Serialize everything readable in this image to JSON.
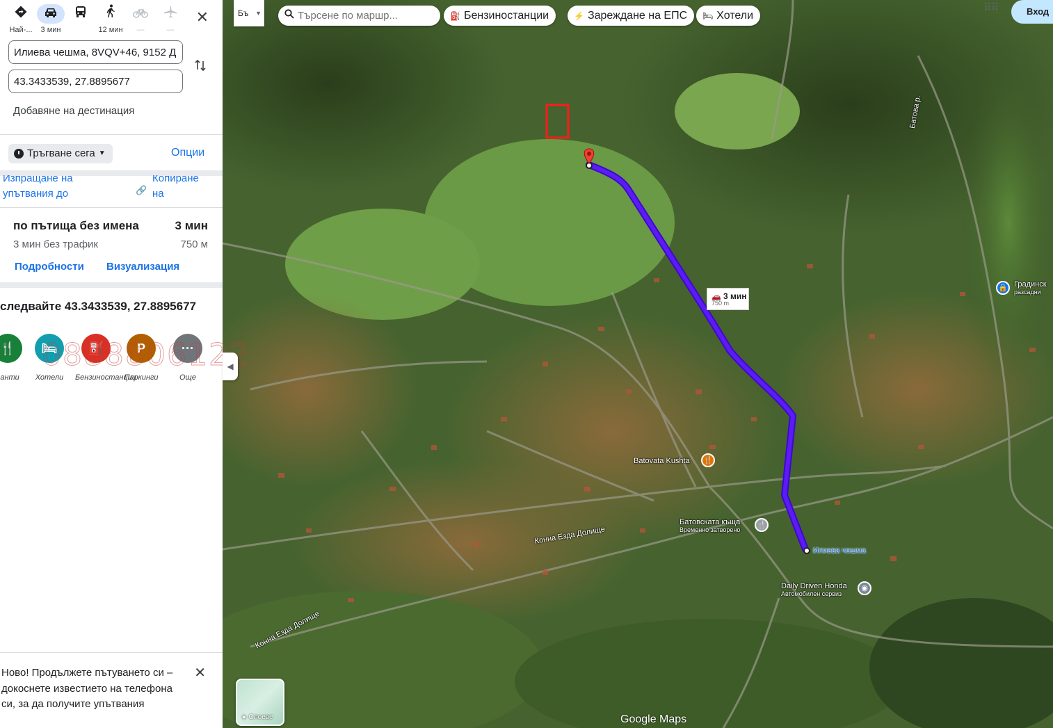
{
  "travel_modes": [
    {
      "icon": "directions-icon",
      "glyph": "◆",
      "label": "Най-...",
      "state": "normal"
    },
    {
      "icon": "car-icon",
      "glyph": "🚗",
      "label": "3 мин",
      "state": "active"
    },
    {
      "icon": "transit-icon",
      "glyph": "🚌",
      "label": "",
      "state": "normal"
    },
    {
      "icon": "walk-icon",
      "glyph": "🚶",
      "label": "12 мин",
      "state": "normal"
    },
    {
      "icon": "bike-icon",
      "glyph": "🚲",
      "label": "—",
      "state": "disabled"
    },
    {
      "icon": "flight-icon",
      "glyph": "✈",
      "label": "—",
      "state": "disabled"
    }
  ],
  "directions": {
    "origin_value": "Илиева чешма, 8VQV+46, 9152 Д",
    "destination_value": "43.3433539, 27.8895677",
    "add_destination": "Добавяне на дестинация",
    "depart_label": "Тръгване сега",
    "options_label": "Опции",
    "cut_left": "Изпращане на\nупътвания до\n...",
    "cut_right": "Копиране\nна\n..."
  },
  "route": {
    "title": "по пътища без имена",
    "time": "3 мин",
    "subtitle": "3 мин без трафик",
    "distance": "750 м",
    "details_link": "Подробности",
    "preview_link": "Визуализация"
  },
  "follow": "следвайте 43.3433539, 27.8895677",
  "categories": [
    {
      "icon": "restaurant-icon",
      "glyph": "🍴",
      "label": "ранти",
      "color": "#188038"
    },
    {
      "icon": "hotel-icon",
      "glyph": "🛏",
      "label": "Хотели",
      "color": "#129eaf"
    },
    {
      "icon": "gas-station-icon",
      "glyph": "⛽",
      "label": "Бензиностанции",
      "color": "#d93025"
    },
    {
      "icon": "parking-icon",
      "glyph": "P",
      "label": "Паркинги",
      "color": "#b06000"
    },
    {
      "icon": "more-icon",
      "glyph": "···",
      "label": "Още",
      "color": "#70757a"
    }
  ],
  "watermark": "0888806122",
  "notification": {
    "text": "Ново! Продължете пътуването си – докоснете известието на телефона си, за да получите упътвания"
  },
  "map": {
    "lang_label": "Бъ",
    "search_placeholder": "Търсене по маршр...",
    "chips": [
      {
        "icon": "gas-station-icon",
        "glyph": "⛽",
        "label": "Бензиностанции"
      },
      {
        "icon": "ev-charging-icon",
        "glyph": "⚡",
        "label": "Зареждане на ЕПС"
      },
      {
        "icon": "hotel-icon",
        "glyph": "🛏",
        "label": "Хотели"
      }
    ],
    "signin_label": "Вход",
    "layers_label": "Слоеве",
    "logo": "Google Maps",
    "route_label_time": "3 мин",
    "route_label_dist": "750 m",
    "places": [
      {
        "name": "Batovata Kushta"
      },
      {
        "name": "Батовската къща",
        "sub": "Временно затворено"
      },
      {
        "name": "Илиева чешма"
      },
      {
        "name": "Daily Driven Honda",
        "sub": "Автомобилен сервиз"
      },
      {
        "name": "Градинск",
        "sub": "разсадни"
      },
      {
        "name": "Конна Езда Долище"
      },
      {
        "name": "Конна Езда Долище"
      },
      {
        "name": "Батова р."
      }
    ],
    "colors": {
      "route": "#5c1bf5",
      "pin": "#ea4335"
    }
  }
}
